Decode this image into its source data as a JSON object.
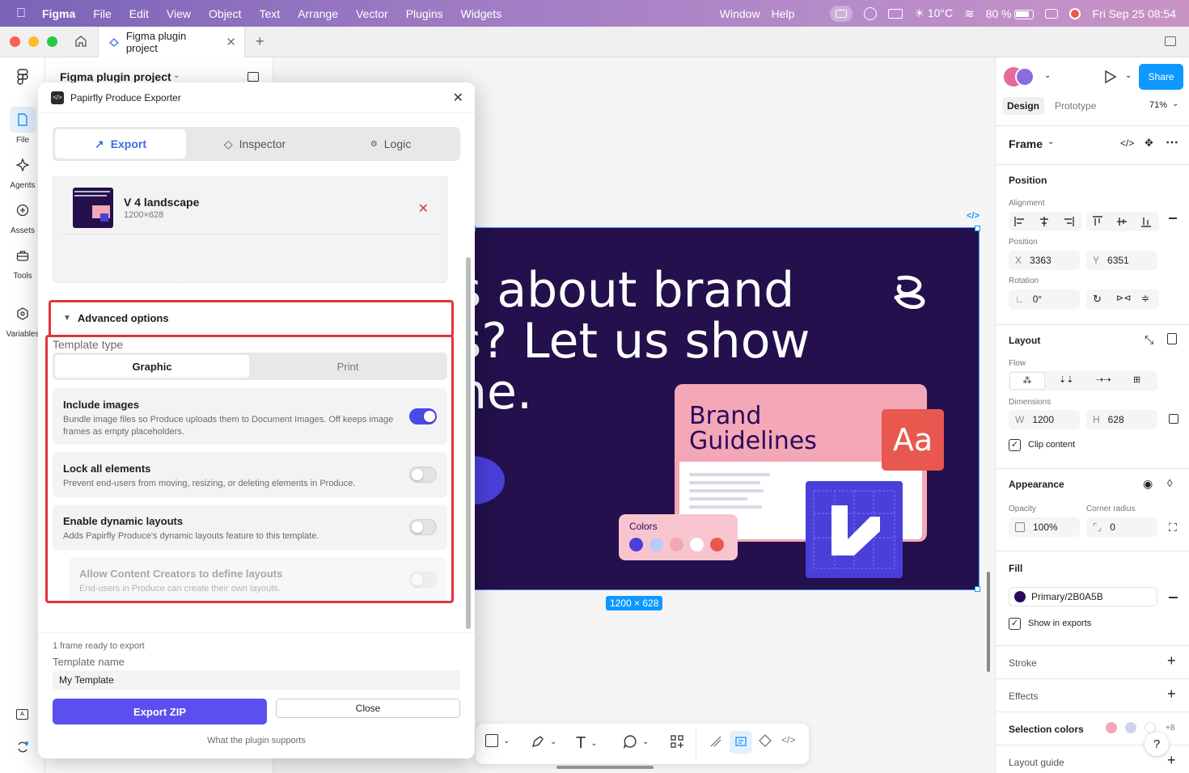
{
  "menubar": {
    "app": "Figma",
    "items": [
      "File",
      "Edit",
      "View",
      "Object",
      "Text",
      "Arrange",
      "Vector",
      "Plugins",
      "Widgets"
    ],
    "right_items": [
      "Window",
      "Help"
    ],
    "weather": "10°C",
    "battery": "80 %",
    "datetime": "Fri Sep 25  08:54"
  },
  "tabbar": {
    "doc_tab": "Figma plugin project"
  },
  "rail": {
    "items": [
      {
        "label": "File",
        "icon": "file-icon"
      },
      {
        "label": "Agents",
        "icon": "agents-icon"
      },
      {
        "label": "Assets",
        "icon": "assets-icon"
      },
      {
        "label": "Tools",
        "icon": "tools-icon"
      },
      {
        "label": "Variables",
        "icon": "variables-icon"
      }
    ]
  },
  "layers": {
    "project_name": "Figma plugin project"
  },
  "plugin": {
    "title": "Papirfly Produce Exporter",
    "tabs": [
      {
        "label": "Export",
        "icon": "arrow-up-right-icon"
      },
      {
        "label": "Inspector",
        "icon": "diamond-icon"
      },
      {
        "label": "Logic",
        "icon": "gear-icon"
      }
    ],
    "frame_item": {
      "name": "V 4 landscape",
      "size": "1200×628"
    },
    "advanced_label": "Advanced options",
    "template_type_label": "Template type",
    "template_types": [
      "Graphic",
      "Print"
    ],
    "options": [
      {
        "title": "Include images",
        "desc": "Bundle image files so Produce uploads them to Document Images. Off keeps image frames as empty placeholders.",
        "on": true
      },
      {
        "title": "Lock all elements",
        "desc": "Prevent end-users from moving, resizing, or deleting elements in Produce.",
        "on": false
      },
      {
        "title": "Enable dynamic layouts",
        "desc": "Adds Papirfly Produce's dynamic layouts feature to this template.",
        "on": false
      },
      {
        "title": "Allow Content Creators to define layouts",
        "desc": "End-users in Produce can create their own layouts.",
        "on": false
      }
    ],
    "footer": {
      "status": "1 frame ready to export",
      "template_name_label": "Template name",
      "template_name_value": "My Template",
      "export_button": "Export ZIP",
      "close_button": "Close",
      "supports_link": "What the plugin supports"
    }
  },
  "canvas": {
    "hero_text": "s about brand\ns? Let us show\nne.",
    "brand_card_title": "Brand\nGuidelines",
    "aa_tile": "Aa",
    "colors_label": "Colors",
    "swatches": [
      "#4b3fd9",
      "#b8cdf5",
      "#f1a7b4",
      "#ffffff",
      "#e8584f"
    ],
    "size_badge": "1200 × 628"
  },
  "rightpanel": {
    "share": "Share",
    "tabs": [
      "Design",
      "Prototype"
    ],
    "zoom": "71%",
    "frame_label": "Frame",
    "position": {
      "title": "Position",
      "alignment_label": "Alignment",
      "position_label": "Position",
      "x_label": "X",
      "x": "3363",
      "y_label": "Y",
      "y": "6351",
      "rotation_label": "Rotation",
      "rotation": "0°"
    },
    "layout": {
      "title": "Layout",
      "flow_label": "Flow",
      "dimensions_label": "Dimensions",
      "w_label": "W",
      "w": "1200",
      "h_label": "H",
      "h": "628",
      "clip_label": "Clip content"
    },
    "appearance": {
      "title": "Appearance",
      "opacity_label": "Opacity",
      "opacity": "100%",
      "radius_label": "Corner radius",
      "radius": "0"
    },
    "fill": {
      "title": "Fill",
      "value": "Primary/2B0A5B",
      "show_exports": "Show in exports",
      "color": "#2b0a5b"
    },
    "stroke": "Stroke",
    "effects": "Effects",
    "selection_colors": "Selection colors",
    "selection_more": "+8",
    "layout_guide": "Layout guide"
  },
  "colors": {
    "accent": "#4a4ae6",
    "highlight": "#e0343e",
    "figma_blue": "#0d99ff"
  }
}
